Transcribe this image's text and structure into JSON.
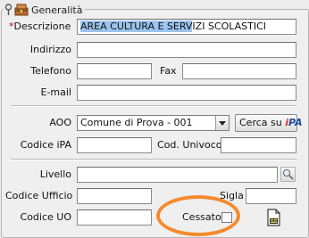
{
  "group": {
    "title": "Generalità"
  },
  "fields": {
    "descrizione": {
      "label": "Descrizione",
      "required_mark": "*",
      "value_selected": "AREA CULTURA E SERV",
      "value_rest": "IZI SCOLASTICI"
    },
    "indirizzo": {
      "label": "Indirizzo",
      "value": ""
    },
    "telefono": {
      "label": "Telefono",
      "value": ""
    },
    "fax": {
      "label": "Fax",
      "value": ""
    },
    "email": {
      "label": "E-mail",
      "value": ""
    },
    "aoo": {
      "label": "AOO",
      "value": "Comune di Prova - 001"
    },
    "cerca_ipa": {
      "label": "Cerca su",
      "logo": "iPA"
    },
    "codice_ipa": {
      "label": "Codice iPA",
      "value": ""
    },
    "cod_univoco": {
      "label": "Cod. Univoco",
      "value": ""
    },
    "livello": {
      "label": "Livello",
      "value": ""
    },
    "codice_ufficio": {
      "label": "Codice Ufficio",
      "value": ""
    },
    "sigla": {
      "label": "Sigla",
      "value": ""
    },
    "codice_uo": {
      "label": "Codice UO",
      "value": ""
    },
    "cessato": {
      "label": "Cessato",
      "checked": false
    }
  },
  "icons": {
    "pin": "pin-icon",
    "group": "chest-icon",
    "combo_arrow": "chevron-down-icon",
    "search": "magnifier-icon",
    "document": "document-icon"
  },
  "colors": {
    "highlight_ring": "#f58a2c",
    "required_mark": "#c00000",
    "selection": "#9cc4ee"
  }
}
